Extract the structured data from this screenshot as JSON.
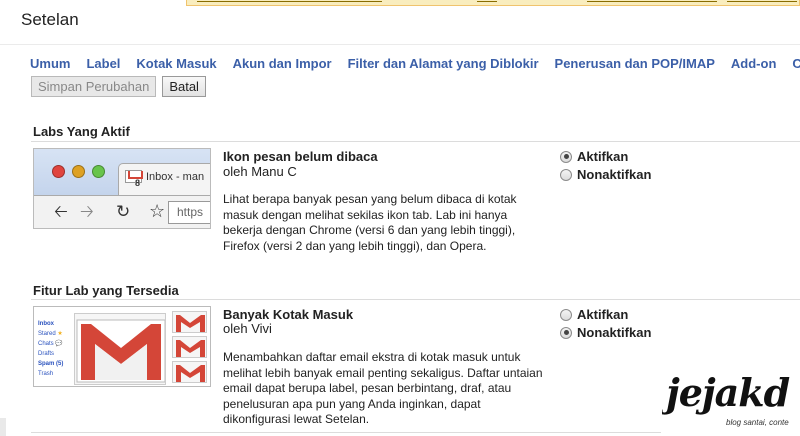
{
  "page": {
    "title": "Setelan"
  },
  "tabs": [
    "Umum",
    "Label",
    "Kotak Masuk",
    "Akun dan Impor",
    "Filter dan Alamat yang Diblokir",
    "Penerusan dan POP/IMAP",
    "Add-on",
    "Ch"
  ],
  "buttons": {
    "save": "Simpan Perubahan",
    "cancel": "Batal"
  },
  "sections": {
    "active": {
      "heading": "Labs Yang Aktif",
      "lab": {
        "title": "Ikon pesan belum dibaca",
        "author": "oleh Manu C",
        "description": "Lihat berapa banyak pesan yang belum dibaca di kotak masuk dengan melihat sekilas ikon tab. Lab ini hanya bekerja dengan Chrome (versi 6 dan yang lebih tinggi), Firefox (versi 2 dan yang lebih tinggi), dan Opera.",
        "options": [
          {
            "label": "Aktifkan",
            "selected": true
          },
          {
            "label": "Nonaktifkan",
            "selected": false
          }
        ],
        "thumbnail": {
          "tab_badge": "8",
          "tab_label": "Inbox - man",
          "url_text": "https"
        }
      }
    },
    "available": {
      "heading": "Fitur Lab yang Tersedia",
      "lab": {
        "title": "Banyak Kotak Masuk",
        "author": "oleh Vivi",
        "description": "Menambahkan daftar email ekstra di kotak masuk untuk melihat lebih banyak email penting sekaligus. Daftar untaian email dapat berupa label, pesan berbintang, draf, atau penelusuran apa pun yang Anda inginkan, dapat dikonfigurasi lewat Setelan.",
        "options": [
          {
            "label": "Aktifkan",
            "selected": false
          },
          {
            "label": "Nonaktifkan",
            "selected": true
          }
        ],
        "thumbnail": {
          "sidebar": [
            "Inbox",
            "Stared",
            "Chats",
            "Drafts",
            "Spam (5)",
            "Trash"
          ]
        }
      }
    }
  },
  "watermark": {
    "text": "jejakd",
    "subtitle": "blog santai, conte"
  },
  "colors": {
    "link": "#3b5fa8",
    "gmail_red": "#d44638",
    "star": "#f2b01e",
    "notif_bg": "#f9edbe"
  }
}
